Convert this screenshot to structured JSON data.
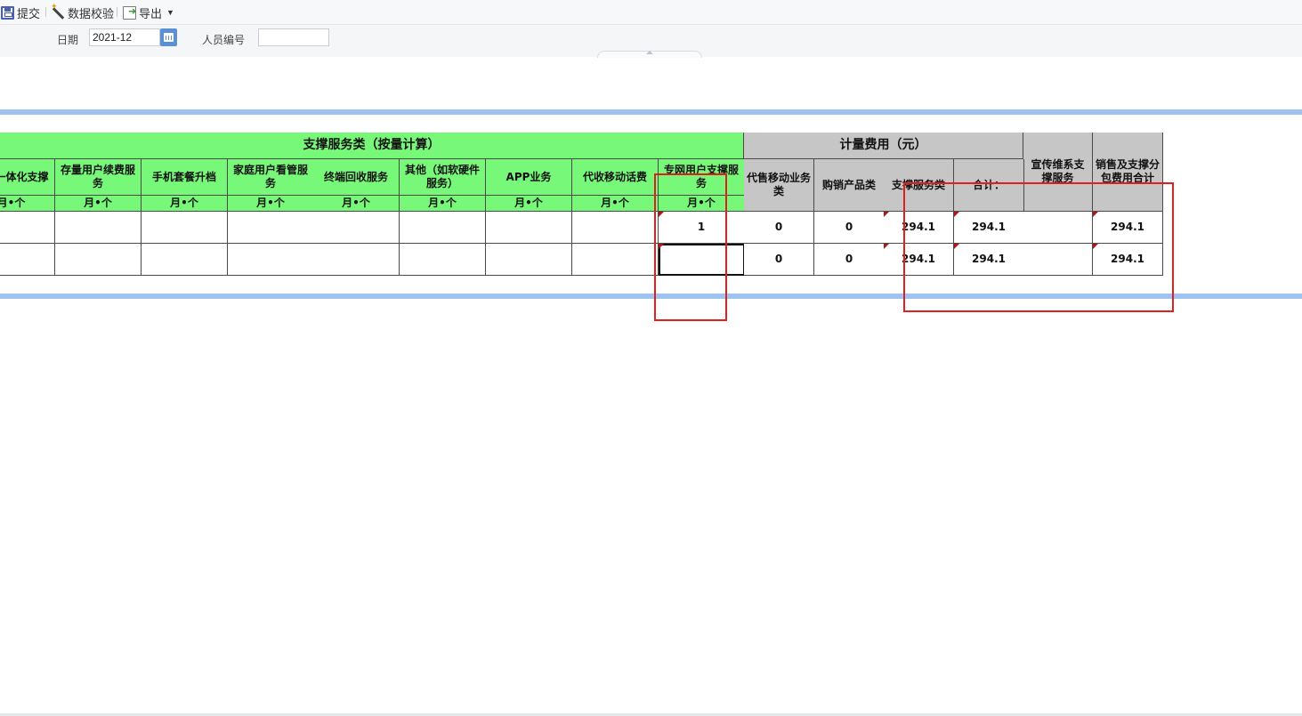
{
  "toolbar": {
    "submit": "提交",
    "validate": "数据校验",
    "export": "导出"
  },
  "filters": {
    "date_label": "日期",
    "date_value": "2021-12",
    "person_label": "人员编号",
    "person_value": ""
  },
  "table": {
    "group_green": "支撑服务类（按量计算）",
    "group_gray": "计量费用（元）",
    "col_propaganda": "宣传维系支撑服务",
    "col_total": "销售及支撑分包费用合计",
    "green_cols": [
      "企业一体化支撑",
      "存量用户续费服务",
      "手机套餐升档",
      "家庭用户看管服务",
      "终端回收服务",
      "其他（如软硬件服务）",
      "APP业务",
      "代收移动话费",
      "专网用户支撑服务"
    ],
    "unit": "月•个",
    "gray_cols": [
      "代售移动业务类",
      "购销产品类",
      "支撑服务类",
      "合计："
    ],
    "rows": [
      {
        "green": [
          "",
          "",
          "",
          "",
          "",
          "",
          "",
          "",
          "1"
        ],
        "gray": [
          "0",
          "0",
          "294.1",
          "294.1"
        ],
        "propaganda": "",
        "total": "294.1"
      },
      {
        "green": [
          "",
          "",
          "",
          "",
          "",
          "",
          "",
          "",
          ""
        ],
        "gray": [
          "0",
          "0",
          "294.1",
          "294.1"
        ],
        "propaganda": "",
        "total": "294.1"
      }
    ]
  }
}
